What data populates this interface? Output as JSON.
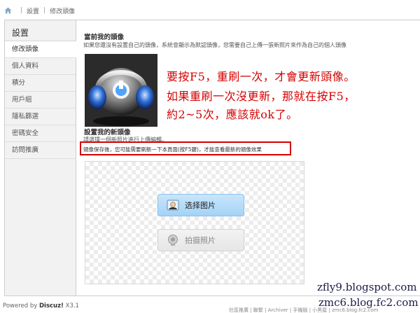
{
  "breadcrumb": {
    "home_icon": "home-icon",
    "items": [
      "設置",
      "修改頭像"
    ],
    "separator": "|"
  },
  "sidebar": {
    "title": "設置",
    "items": [
      "修改頭像",
      "個人資料",
      "積分",
      "用戶組",
      "隱私篩選",
      "密碼安全",
      "訪問推廣"
    ]
  },
  "current": {
    "title": "當前我的頭像",
    "desc": "如果您還沒有設置自己的頭像，系統會顯示為默認頭像，您需要自己上傳一張新照片來作為自己的個人頭像"
  },
  "annotation": {
    "line1": "要按F5，重刷一次，才會更新頭像。",
    "line2": "如果重刷一次沒更新，那就在按F5，",
    "line3": "約2~5次，應該就ok了。",
    "color": "#d60000"
  },
  "newavatar": {
    "title": "設置我的新頭像",
    "desc": "請選擇一個新照片進行上傳編輯。",
    "hint": "頭像保存後，您可能需要刷新一下本頁面(按F5鍵)，才能查看最新的頭像效果"
  },
  "upload": {
    "choose_label": "选择图片",
    "photo_label": "拍摄照片",
    "choose_icon": "portrait-icon",
    "photo_icon": "webcam-icon"
  },
  "footer": {
    "powered_prefix": "Powered by",
    "brand": "Discuz!",
    "version": "X3.1",
    "links": "社區推廣 | 聯繫 | Archiver | 手機版 | 小黑屋 | zmc6.blog.fc2.com"
  },
  "watermarks": [
    "zfly9.blogspot.com",
    "zmc6.blog.fc2.com"
  ]
}
